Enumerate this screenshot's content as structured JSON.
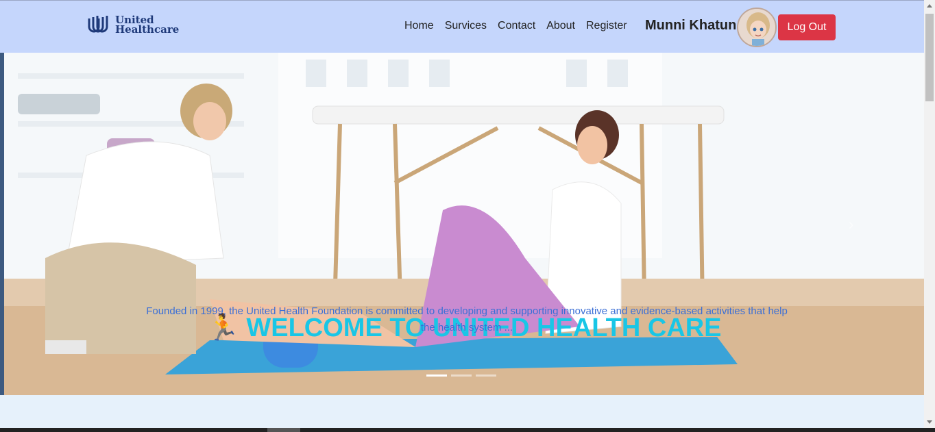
{
  "brand": {
    "line1": "United",
    "line2": "Healthcare"
  },
  "nav": {
    "items": [
      "Home",
      "Survices",
      "Contact",
      "About",
      "Register"
    ]
  },
  "user": {
    "name": "Munni Khatun"
  },
  "logout_label": "Log Out",
  "hero": {
    "title": "WELCOME TO UNITED HEALTH CARE",
    "description": "Founded in 1999, the United Health Foundation is committed to developing and supporting innovative and evidence-based activities that help the health system ..."
  },
  "colors": {
    "navbar": "#c5d6fc",
    "logout": "#dc3545",
    "title": "#19c6e6",
    "description": "#3b6fd6"
  },
  "icons": [
    "united-healthcare-logo-icon",
    "runner-icon",
    "carousel-next-icon"
  ]
}
